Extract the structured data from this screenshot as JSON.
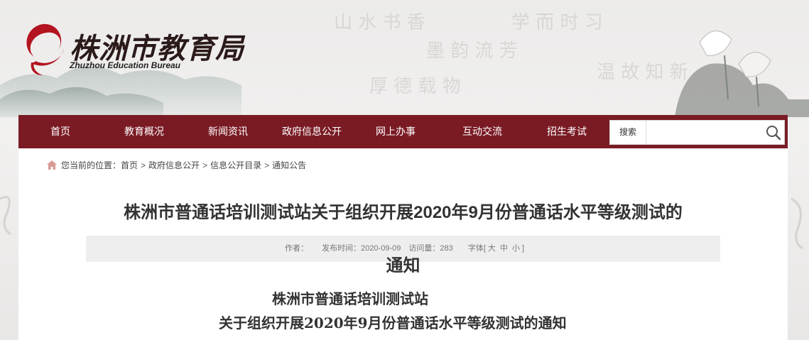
{
  "site": {
    "logo_cn": "株洲市教育局",
    "logo_en": "Zhuzhou Education Bureau"
  },
  "nav": {
    "items": [
      "首页",
      "教育概况",
      "新闻资讯",
      "政府信息公开",
      "网上办事",
      "互动交流",
      "招生考试"
    ],
    "search_label": "搜索",
    "search_value": ""
  },
  "breadcrumb": {
    "prefix": "您当前的位置：",
    "items": [
      "首页",
      "政府信息公开",
      "信息公开目录",
      "通知公告"
    ],
    "separator": ">"
  },
  "article": {
    "title_line1": "株洲市普通话培训测试站关于组织开展2020年9月份普通话水平等级测试的",
    "title_line2": "通知",
    "meta": {
      "author_label": "作者：",
      "author": "",
      "publish_label": "发布时间：",
      "publish_date": "2020-09-09",
      "views_label": "访问量：",
      "views": "283",
      "font_label": "字体[",
      "font_options": [
        "大",
        "中",
        "小"
      ],
      "font_close": "]"
    },
    "body_line1": "株洲市普通话培训测试站",
    "body_line2": "关于组织开展2020年9月份普通话水平等级测试的通知"
  },
  "colors": {
    "nav_bg": "#7a1b24",
    "logo_red": "#b3141f",
    "meta_bg": "#eeeeee"
  }
}
